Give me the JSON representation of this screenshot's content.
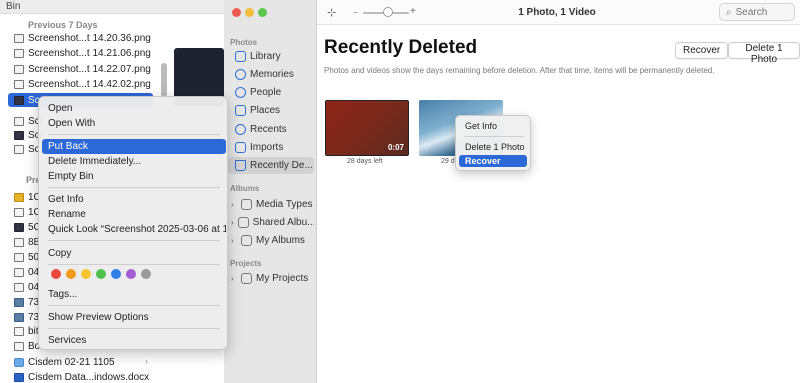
{
  "finder": {
    "title": "Bin",
    "section_prev7": "Previous 7 Days",
    "section_prev30": "Pre",
    "files_top": [
      "Screenshot...t 14.20.36.png",
      "Screenshot...t 14.21.06.png",
      "Screenshot...t 14.22.07.png",
      "Screenshot...t 14.42.02.png"
    ],
    "selected_file": "Scr",
    "files_mid": [
      "Scr",
      "Scr",
      "Scr"
    ],
    "files_bottom": [
      "1C",
      "1C",
      "5C",
      "8B",
      "50",
      "04",
      "04",
      "73",
      "73",
      "bit",
      "Bo"
    ],
    "file_folder": "Cisdem 02-21 1105",
    "file_doc": "Cisdem Data...indows.docx",
    "file_last": "Th"
  },
  "context_menu": {
    "open": "Open",
    "open_with": "Open With",
    "put_back": "Put Back",
    "delete_immediately": "Delete Immediately...",
    "empty_bin": "Empty Bin",
    "get_info": "Get Info",
    "rename": "Rename",
    "quick_look": "Quick Look “Screenshot 2025-03-06 at 10",
    "copy": "Copy",
    "tags": "Tags...",
    "show_preview_options": "Show Preview Options",
    "services": "Services",
    "tag_colors": [
      "#e8483b",
      "#f39a1f",
      "#f5c631",
      "#4cc24b",
      "#2f7de6",
      "#a45bd6",
      "#9a9a9a"
    ]
  },
  "photos_sidebar": {
    "section_photos": "Photos",
    "items": [
      "Library",
      "Memories",
      "People",
      "Places",
      "Recents",
      "Imports",
      "Recently De..."
    ],
    "section_albums": "Albums",
    "albums": [
      "Media Types",
      "Shared Albu...",
      "My Albums"
    ],
    "section_projects": "Projects",
    "projects": [
      "My Projects"
    ]
  },
  "photos_main": {
    "toolbar_title": "1 Photo, 1 Video",
    "search_placeholder": "Search",
    "heading": "Recently Deleted",
    "recover_button": "Recover",
    "delete_button": "Delete 1 Photo",
    "subtitle": "Photos and videos show the days remaining before deletion. After that time, items will be permanently deleted.",
    "item1_duration": "0:07",
    "item1_caption": "28 days left",
    "item2_caption": "29 d"
  },
  "photo_context_menu": {
    "get_info": "Get Info",
    "delete": "Delete 1 Photo",
    "recover": "Recover"
  }
}
